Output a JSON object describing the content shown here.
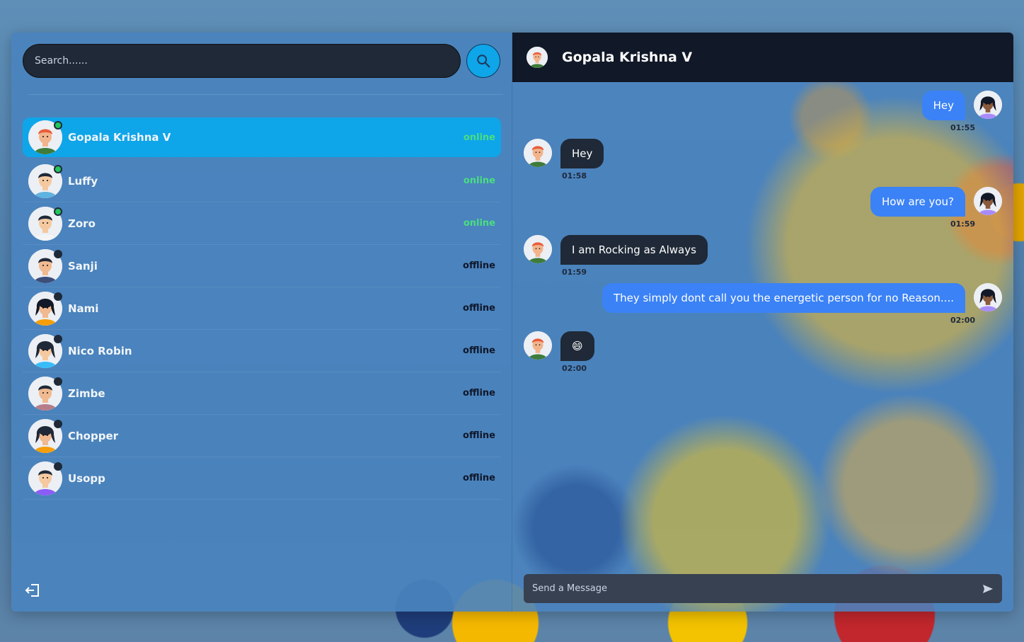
{
  "search": {
    "placeholder": "Search......"
  },
  "users": [
    {
      "name": "Gopala Krishna V",
      "status": "online",
      "active": true,
      "skin": "#f2b48c",
      "hair": "#e85d3b",
      "shirt": "#3f7b3a"
    },
    {
      "name": "Luffy",
      "status": "online",
      "active": false,
      "skin": "#f5c9a0",
      "hair": "#1f2937",
      "shirt": "#5fb3e0"
    },
    {
      "name": "Zoro",
      "status": "online",
      "active": false,
      "skin": "#f5c9a0",
      "hair": "#1f2937",
      "shirt": "#f3f4f6"
    },
    {
      "name": "Sanji",
      "status": "offline",
      "active": false,
      "skin": "#f0b98f",
      "hair": "#1f2937",
      "shirt": "#3b4f7a"
    },
    {
      "name": "Nami",
      "status": "offline",
      "active": false,
      "skin": "#f0b98f",
      "hair": "#111827",
      "shirt": "#f59e0b"
    },
    {
      "name": "Nico Robin",
      "status": "offline",
      "active": false,
      "skin": "#f5c9a0",
      "hair": "#1f2937",
      "shirt": "#38bdf8"
    },
    {
      "name": "Zimbe",
      "status": "offline",
      "active": false,
      "skin": "#f0b98f",
      "hair": "#1f2937",
      "shirt": "#b77d8a"
    },
    {
      "name": "Chopper",
      "status": "offline",
      "active": false,
      "skin": "#f0b98f",
      "hair": "#1f2937",
      "shirt": "#f59e0b"
    },
    {
      "name": "Usopp",
      "status": "offline",
      "active": false,
      "skin": "#f5c9a0",
      "hair": "#1f2937",
      "shirt": "#8b5cf6"
    }
  ],
  "chat": {
    "title": "Gopala Krishna V",
    "messages": [
      {
        "side": "right",
        "text": "Hey",
        "time": "01:55"
      },
      {
        "side": "left",
        "text": "Hey",
        "time": "01:58"
      },
      {
        "side": "right",
        "text": "How are you?",
        "time": "01:59"
      },
      {
        "side": "left",
        "text": "I am Rocking as Always",
        "time": "01:59"
      },
      {
        "side": "right",
        "text": "They simply dont call you the energetic person for no Reason....",
        "time": "02:00"
      },
      {
        "side": "left",
        "text": "😄",
        "time": "02:00"
      }
    ],
    "composer_placeholder": "Send a Message"
  },
  "colors": {
    "accent": "#0ea5e9",
    "online": "#4ade80",
    "bubble_me": "#3b82f6",
    "bubble_them": "#1f2937"
  },
  "icons": {
    "search": "search-icon",
    "logout": "logout-icon",
    "send": "send-icon"
  }
}
